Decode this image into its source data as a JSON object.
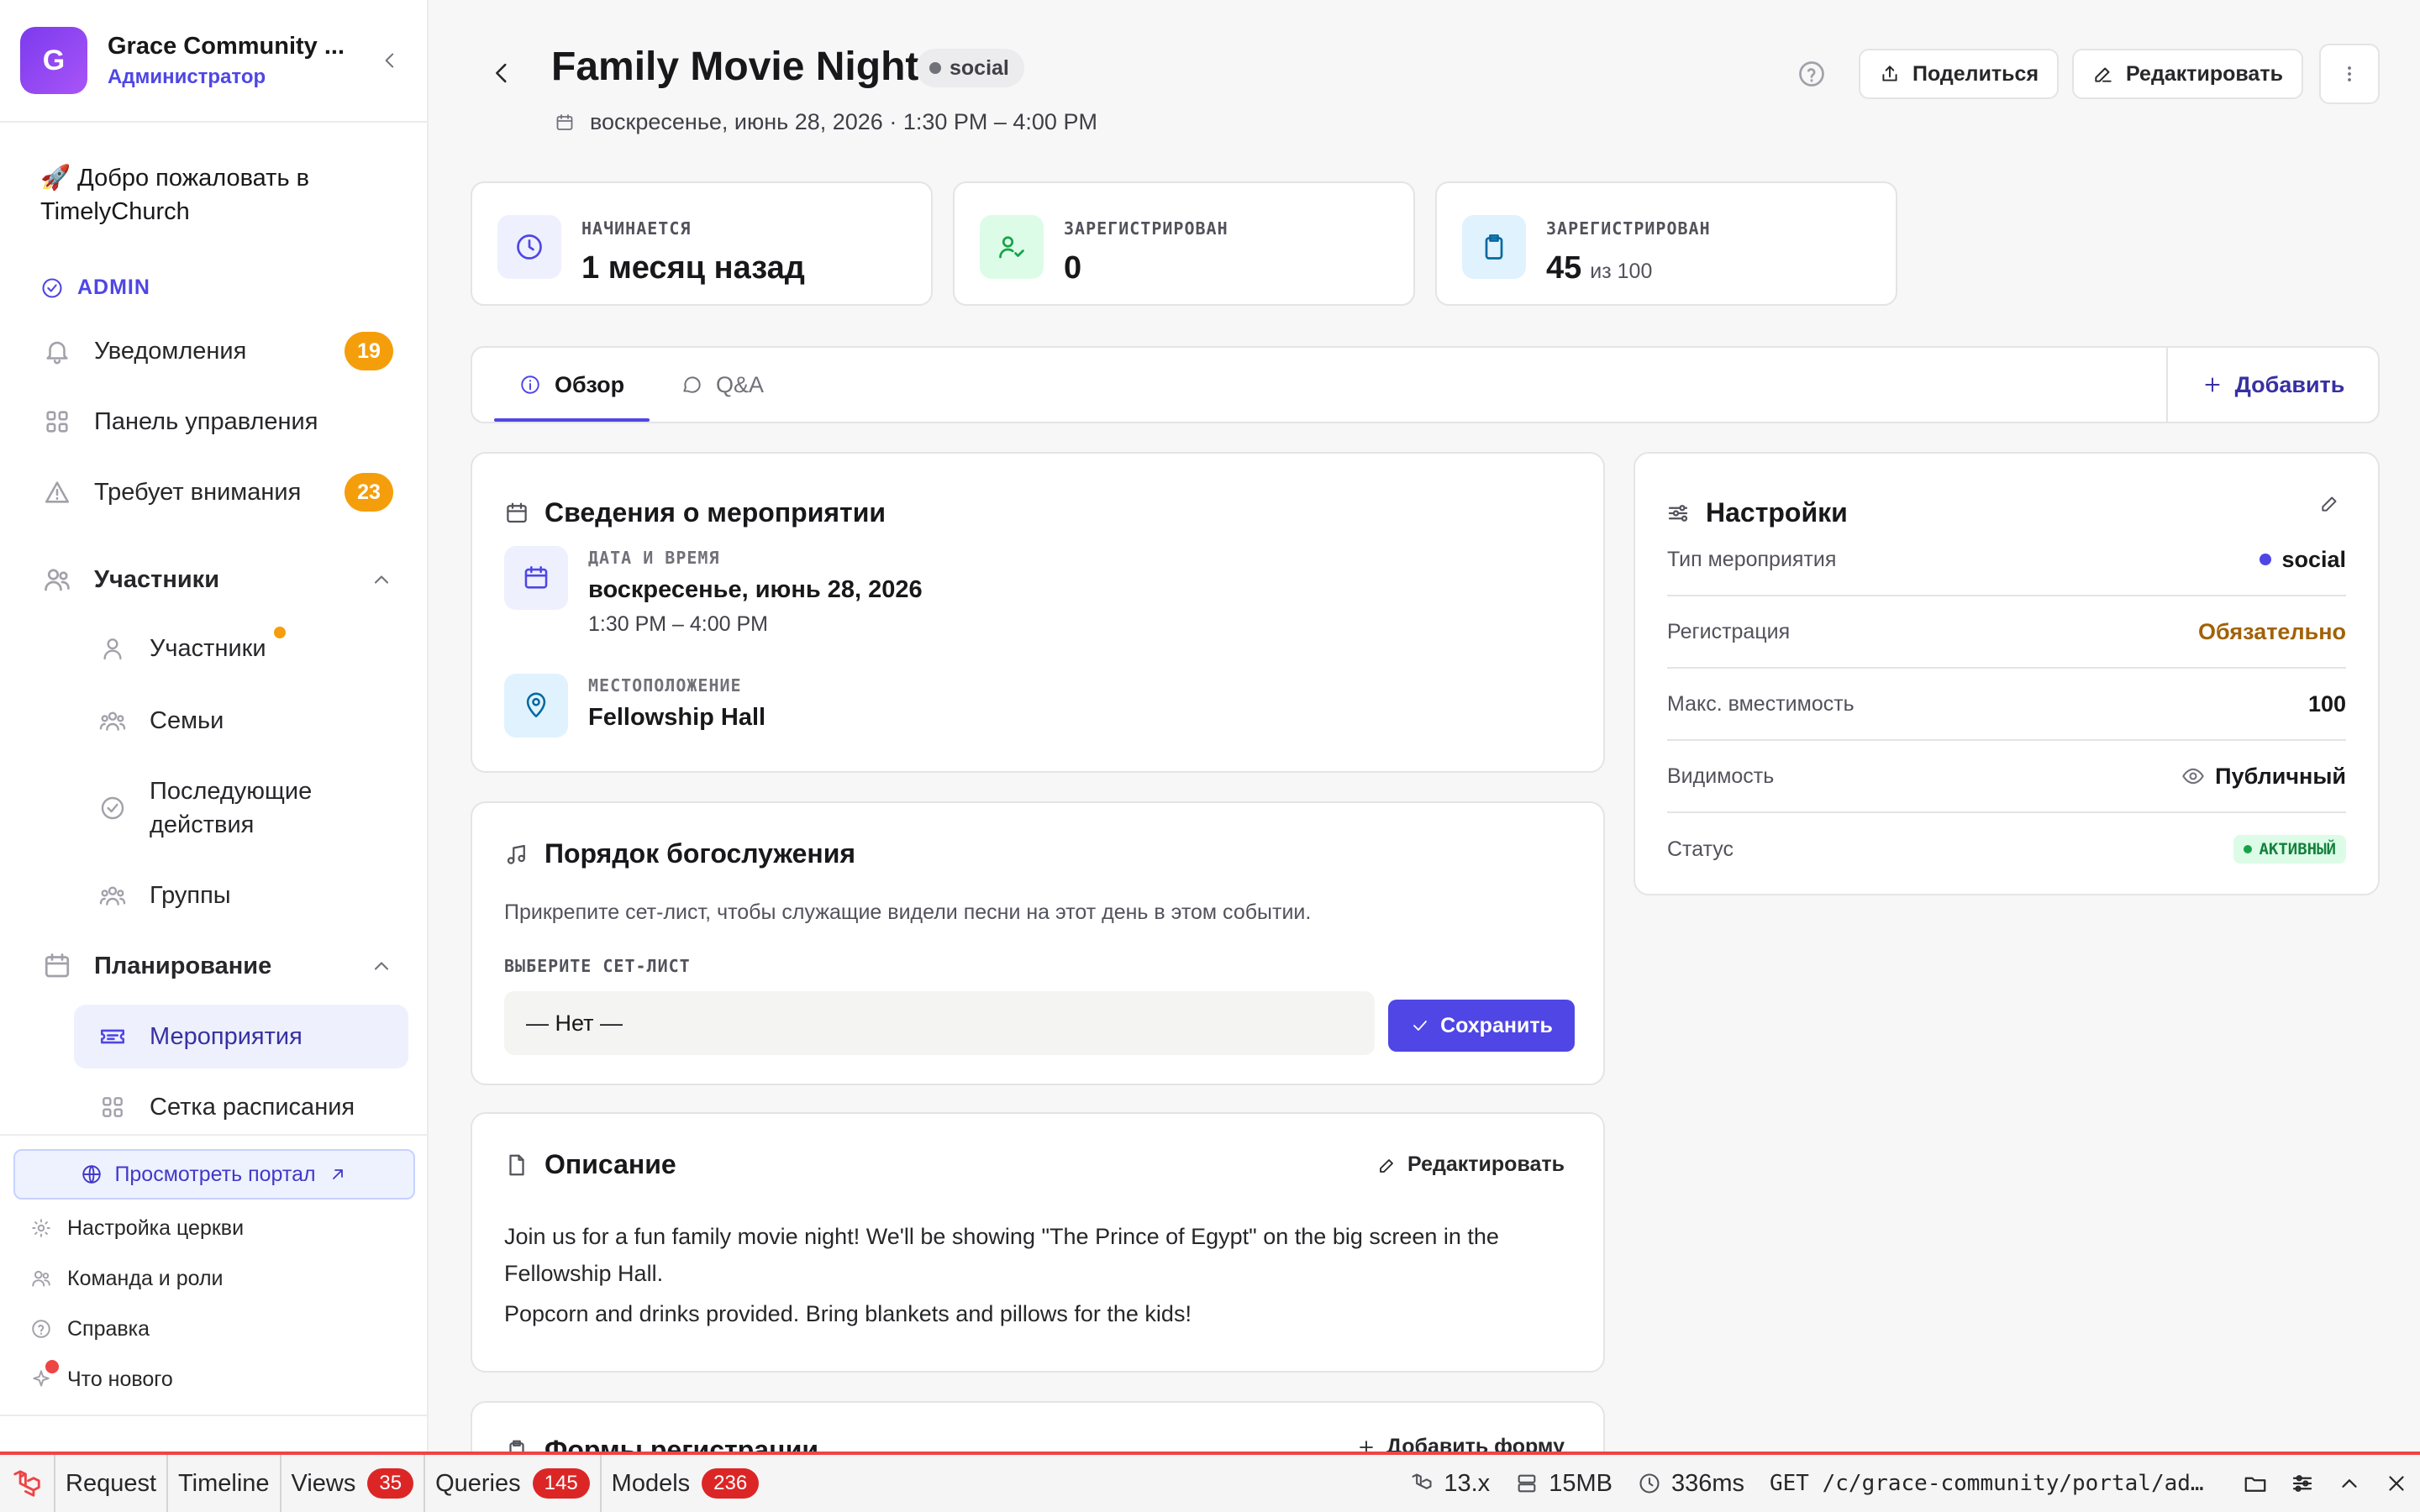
{
  "org": {
    "initial": "G",
    "name": "Grace Community ...",
    "role": "Администратор"
  },
  "sidebar": {
    "welcome": "🚀 Добро пожаловать в TimelyChurch",
    "admin_label": "ADMIN",
    "items": [
      {
        "label": "Уведомления",
        "badge": "19"
      },
      {
        "label": "Панель управления"
      },
      {
        "label": "Требует внимания",
        "badge": "23"
      }
    ],
    "people_group": {
      "label": "Участники",
      "items": [
        "Участники",
        "Семьи",
        "Последующие действия",
        "Группы"
      ]
    },
    "planning_group": {
      "label": "Планирование",
      "items": [
        "Мероприятия",
        "Сетка расписания"
      ]
    },
    "portal_button": "Просмотреть портал",
    "footer_links": [
      "Настройка церкви",
      "Команда и роли",
      "Справка",
      "Что нового"
    ]
  },
  "header": {
    "title": "Family Movie Night",
    "type_badge": "social",
    "datetime": "воскресенье, июнь 28, 2026 · 1:30 PM – 4:00 PM",
    "share_label": "Поделиться",
    "edit_label": "Редактировать"
  },
  "stats": [
    {
      "label": "НАЧИНАЕТСЯ",
      "value": "1 месяц назад",
      "icon": "clock-icon"
    },
    {
      "label": "ЗАРЕГИСТРИРОВАН",
      "value": "0",
      "icon": "user-check-icon"
    },
    {
      "label": "ЗАРЕГИСТРИРОВАН",
      "value": "45",
      "sub": "из 100",
      "icon": "clipboard-icon"
    }
  ],
  "tabs": {
    "overview": "Обзор",
    "qa": "Q&A",
    "add": "Добавить"
  },
  "details": {
    "title": "Сведения о мероприятии",
    "date_label": "ДАТА И ВРЕМЯ",
    "date_value": "воскресенье, июнь 28, 2026",
    "time_value": "1:30 PM – 4:00 PM",
    "location_label": "МЕСТОПОЛОЖЕНИЕ",
    "location_value": "Fellowship Hall"
  },
  "service_order": {
    "title": "Порядок богослужения",
    "hint": "Прикрепите сет-лист, чтобы служащие видели песни на этот день в этом событии.",
    "select_label": "ВЫБЕРИТЕ СЕТ-ЛИСТ",
    "select_value": "— Нет —",
    "save_label": "Сохранить"
  },
  "description": {
    "title": "Описание",
    "edit_label": "Редактировать",
    "paragraphs": [
      "Join us for a fun family movie night! We'll be showing \"The Prince of Egypt\" on the big screen in the Fellowship Hall.",
      "Popcorn and drinks provided. Bring blankets and pillows for the kids!"
    ]
  },
  "registration_forms": {
    "title": "Формы регистрации",
    "add_label": "Добавить форму"
  },
  "settings": {
    "title": "Настройки",
    "rows": [
      {
        "key": "Тип мероприятия",
        "value": "social"
      },
      {
        "key": "Регистрация",
        "value": "Обязательно"
      },
      {
        "key": "Макс. вместимость",
        "value": "100"
      },
      {
        "key": "Видимость",
        "value": "Публичный"
      },
      {
        "key": "Статус",
        "value": "АКТИВНЫЙ"
      }
    ]
  },
  "debugbar": {
    "tabs": [
      {
        "label": "Request"
      },
      {
        "label": "Timeline"
      },
      {
        "label": "Views",
        "count": "35"
      },
      {
        "label": "Queries",
        "count": "145"
      },
      {
        "label": "Models",
        "count": "236"
      }
    ],
    "version": "13.x",
    "memory": "15MB",
    "time": "336ms",
    "request": "GET /c/grace-community/portal/admin/events"
  },
  "colors": {
    "accent": "#4f46e5",
    "warning": "#f59e0b",
    "debug_red": "#ef4444",
    "success": "#16a34a"
  }
}
